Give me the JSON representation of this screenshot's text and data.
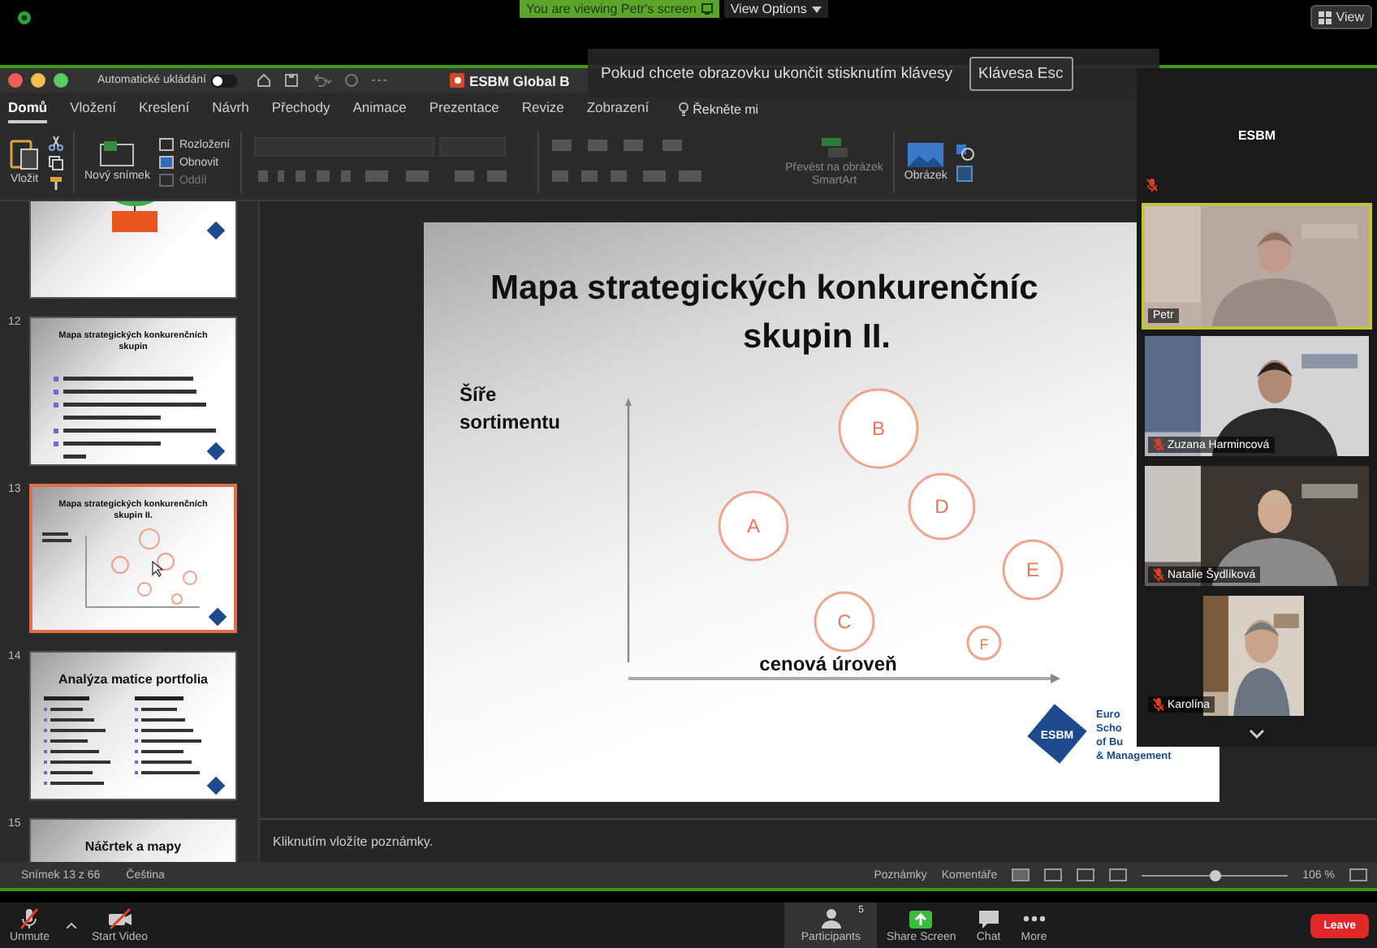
{
  "zoom_top_bar": {
    "banner": "You are viewing Petr's screen",
    "view_options": "View Options",
    "view_button": "View"
  },
  "screen_share_notice": {
    "text": "Pokud chcete obrazovku ukončit stisknutím klávesy",
    "key": "Klávesa Esc"
  },
  "powerpoint": {
    "title_bar": {
      "autosave_label": "Automatické ukládání",
      "autosave_on": false,
      "document_title": "ESBM Global B"
    },
    "ribbon_tabs": [
      {
        "label": "Domů",
        "selected": true
      },
      {
        "label": "Vložení",
        "selected": false
      },
      {
        "label": "Kreslení",
        "selected": false
      },
      {
        "label": "Návrh",
        "selected": false
      },
      {
        "label": "Přechody",
        "selected": false
      },
      {
        "label": "Animace",
        "selected": false
      },
      {
        "label": "Prezentace",
        "selected": false
      },
      {
        "label": "Revize",
        "selected": false
      },
      {
        "label": "Zobrazení",
        "selected": false
      }
    ],
    "tell_me": "Řekněte mi",
    "ribbon": {
      "paste": "Vložit",
      "new_slide": "Nový snímek",
      "layout": "Rozložení",
      "reset": "Obnovit",
      "section": "Oddíl",
      "smartart": "Převést na obrázek SmartArt",
      "picture": "Obrázek"
    },
    "slides": [
      {
        "kind": "diagram",
        "selected": false
      },
      {
        "kind": "bullets",
        "number": "12",
        "title": "Mapa strategických konkurenčních skupin",
        "selected": false
      },
      {
        "kind": "chart",
        "number": "13",
        "title": "Mapa strategických konkurenčních skupin II.",
        "selected": true
      },
      {
        "kind": "columns",
        "number": "14",
        "title": "Analýza matice portfolia",
        "selected": false
      },
      {
        "kind": "title",
        "number": "15",
        "title": "Náčrtek a mapy",
        "selected": false
      }
    ],
    "current_slide": {
      "title_lines": [
        "Mapa strategických konkurenčníc",
        "skupin II."
      ],
      "y_axis_label": [
        "Šíře",
        "sortimentu"
      ],
      "x_axis_label": "cenová úroveň",
      "bubbles": [
        {
          "label": "A"
        },
        {
          "label": "B"
        },
        {
          "label": "C"
        },
        {
          "label": "D"
        },
        {
          "label": "E"
        },
        {
          "label": "F"
        }
      ],
      "logo": "ESBM",
      "logo_text_lines": [
        "Euro",
        "Scho",
        "of Bu",
        "& Management"
      ]
    },
    "notes_placeholder": "Kliknutím vložíte poznámky.",
    "status_bar": {
      "slide_position": "Snímek 13 z 66",
      "language": "Čeština",
      "notes": "Poznámky",
      "comments": "Komentáře",
      "zoom_slider": {
        "level": 0.5
      },
      "zoom_percent": "106 %"
    }
  },
  "participants_panel": {
    "tiles": [
      {
        "kind": "avatar",
        "name": "ESBM",
        "muted": true
      },
      {
        "kind": "video",
        "name": "Petr",
        "muted": false,
        "active": true
      },
      {
        "kind": "video",
        "name": "Zuzana Harmincová",
        "muted": true,
        "active": false
      },
      {
        "kind": "video",
        "name": "Natalie Šydlíková",
        "muted": true,
        "active": false
      },
      {
        "kind": "video_narrow",
        "name": "Karolína",
        "muted": true,
        "active": false
      }
    ]
  },
  "zoom_toolbar": {
    "buttons": [
      {
        "kind": "mic",
        "label": "Unmute"
      },
      {
        "kind": "video",
        "label": "Start Video"
      },
      {
        "kind": "participants",
        "label": "Participants",
        "badge": "5"
      },
      {
        "kind": "share",
        "label": "Share Screen"
      },
      {
        "kind": "chat",
        "label": "Chat"
      },
      {
        "kind": "more",
        "label": "More"
      }
    ],
    "leave": "Leave"
  }
}
